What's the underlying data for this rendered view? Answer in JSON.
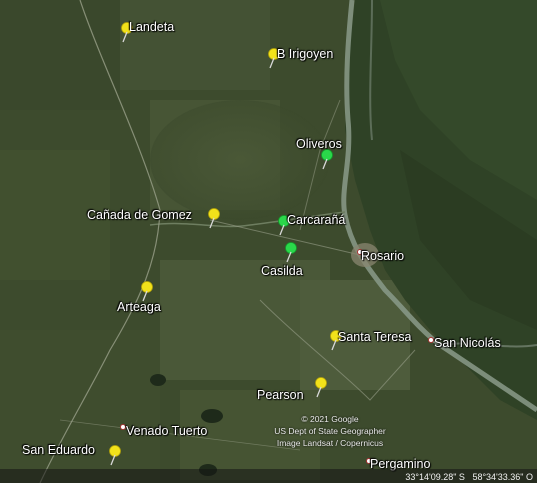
{
  "places": {
    "landeta": "Landeta",
    "b_irigoyen": "B Irigoyen",
    "oliveros": "Oliveros",
    "canada_de_gomez": "Cañada de Gomez",
    "carcarana": "Carcarañá",
    "casilda": "Casilda",
    "rosario": "Rosario",
    "arteaga": "Arteaga",
    "santa_teresa": "Santa Teresa",
    "san_nicolas": "San Nicolás",
    "pearson": "Pearson",
    "venado_tuerto": "Venado Tuerto",
    "san_eduardo": "San Eduardo",
    "pergamino": "Pergamino"
  },
  "attribution": {
    "line1": "© 2021 Google",
    "line2": "US Dept of State Geographer",
    "line3": "Image Landsat / Copernicus"
  },
  "coordinates": {
    "lat": "33°14'09.28\" S",
    "lon": "58°34'33.36\" O"
  },
  "colors": {
    "pin_yellow": "#f2e21a",
    "pin_green": "#2ad84a",
    "terrain": "#3c4a2c"
  },
  "icons": {
    "yellow_pin": "pushpin-yellow-icon",
    "green_pin": "pushpin-green-icon"
  }
}
